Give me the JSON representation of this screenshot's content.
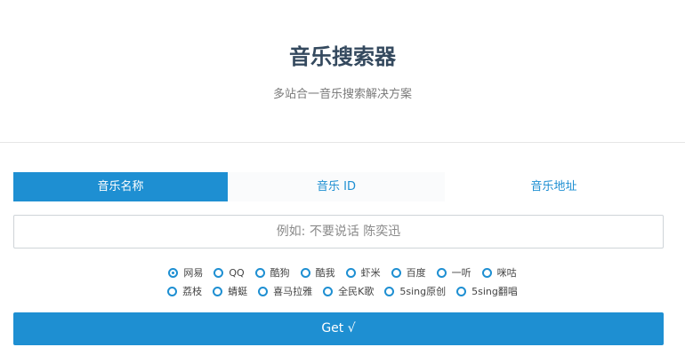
{
  "header": {
    "title": "音乐搜索器",
    "subtitle": "多站合一音乐搜索解决方案"
  },
  "tabs": [
    {
      "label": "音乐名称",
      "active": true
    },
    {
      "label": "音乐 ID",
      "active": false
    },
    {
      "label": "音乐地址",
      "active": false
    }
  ],
  "search": {
    "placeholder": "例如: 不要说话 陈奕迅",
    "value": ""
  },
  "sources": {
    "row1": [
      {
        "label": "网易",
        "checked": true
      },
      {
        "label": "QQ",
        "checked": false
      },
      {
        "label": "酷狗",
        "checked": false
      },
      {
        "label": "酷我",
        "checked": false
      },
      {
        "label": "虾米",
        "checked": false
      },
      {
        "label": "百度",
        "checked": false
      },
      {
        "label": "一听",
        "checked": false
      },
      {
        "label": "咪咕",
        "checked": false
      }
    ],
    "row2": [
      {
        "label": "荔枝",
        "checked": false
      },
      {
        "label": "蜻蜓",
        "checked": false
      },
      {
        "label": "喜马拉雅",
        "checked": false
      },
      {
        "label": "全民K歌",
        "checked": false
      },
      {
        "label": "5sing原创",
        "checked": false
      },
      {
        "label": "5sing翻唱",
        "checked": false
      }
    ]
  },
  "submit": {
    "label": "Get √"
  },
  "colors": {
    "accent": "#1e8fd2",
    "title": "#34495e"
  }
}
